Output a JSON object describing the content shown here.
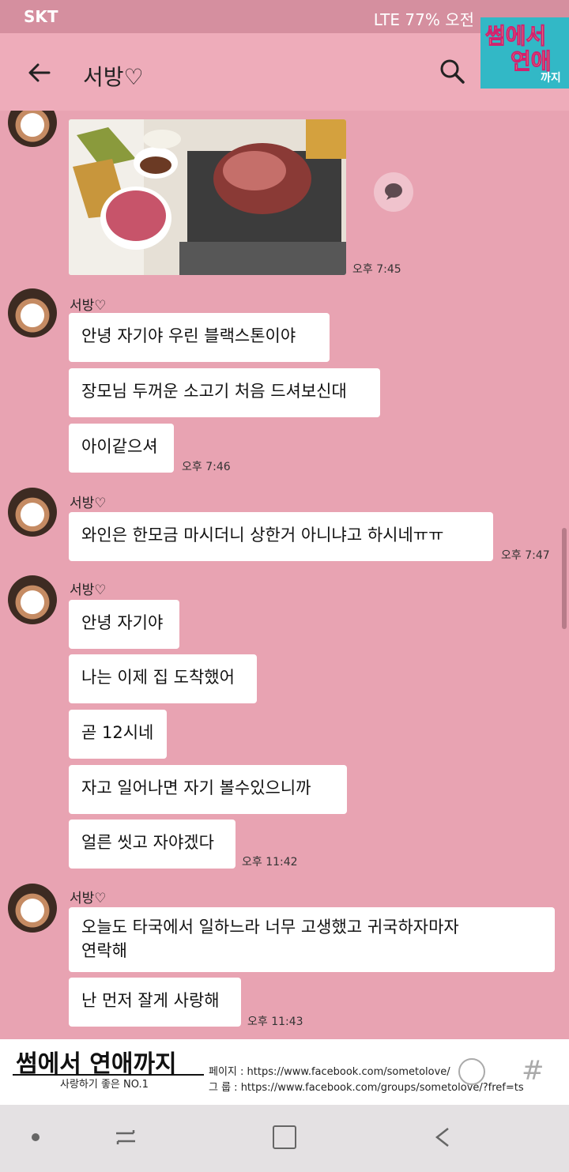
{
  "status_bar": {
    "carrier": "SKT",
    "battery": "77%",
    "right_text": "LTE 77% 오전"
  },
  "header": {
    "title": "서방♡"
  },
  "watermark": {
    "line1": "썸에서",
    "line2": "연애",
    "line3": "까지"
  },
  "messages": [
    {
      "time": "오후 7:45"
    },
    {
      "sender": "서방♡",
      "lines": [
        "안녕 자기야 우린 블랙스톤이야",
        "장모님 두꺼운 소고기 처음 드셔보신대",
        "아이같으셔"
      ],
      "time": "오후 7:46"
    },
    {
      "sender": "서방♡",
      "lines": [
        "와인은 한모금 마시더니 상한거 아니냐고 하시네ㅠㅠ"
      ],
      "time": "오후 7:47"
    },
    {
      "sender": "서방♡",
      "lines": [
        "안녕 자기야",
        "나는 이제 집 도착했어",
        "곧 12시네",
        "자고 일어나면 자기 볼수있으니까",
        "얼른 씻고 자야겠다"
      ],
      "time": "오후 11:42"
    },
    {
      "sender": "서방♡",
      "lines": [
        "오늘도 타국에서 일하느라 너무 고생했고 귀국하자마자",
        "연락해",
        "난 먼저 잘게 사랑해"
      ],
      "time": "오후 11:43"
    }
  ],
  "banner": {
    "logo": "썸에서 연애까지",
    "subtitle": "사랑하기 좋은 NO.1",
    "page_label": "페이지 : https://www.facebook.com/sometolove/",
    "group_label": "그 룹 : https://www.facebook.com/groups/sometolove/?fref=ts"
  }
}
